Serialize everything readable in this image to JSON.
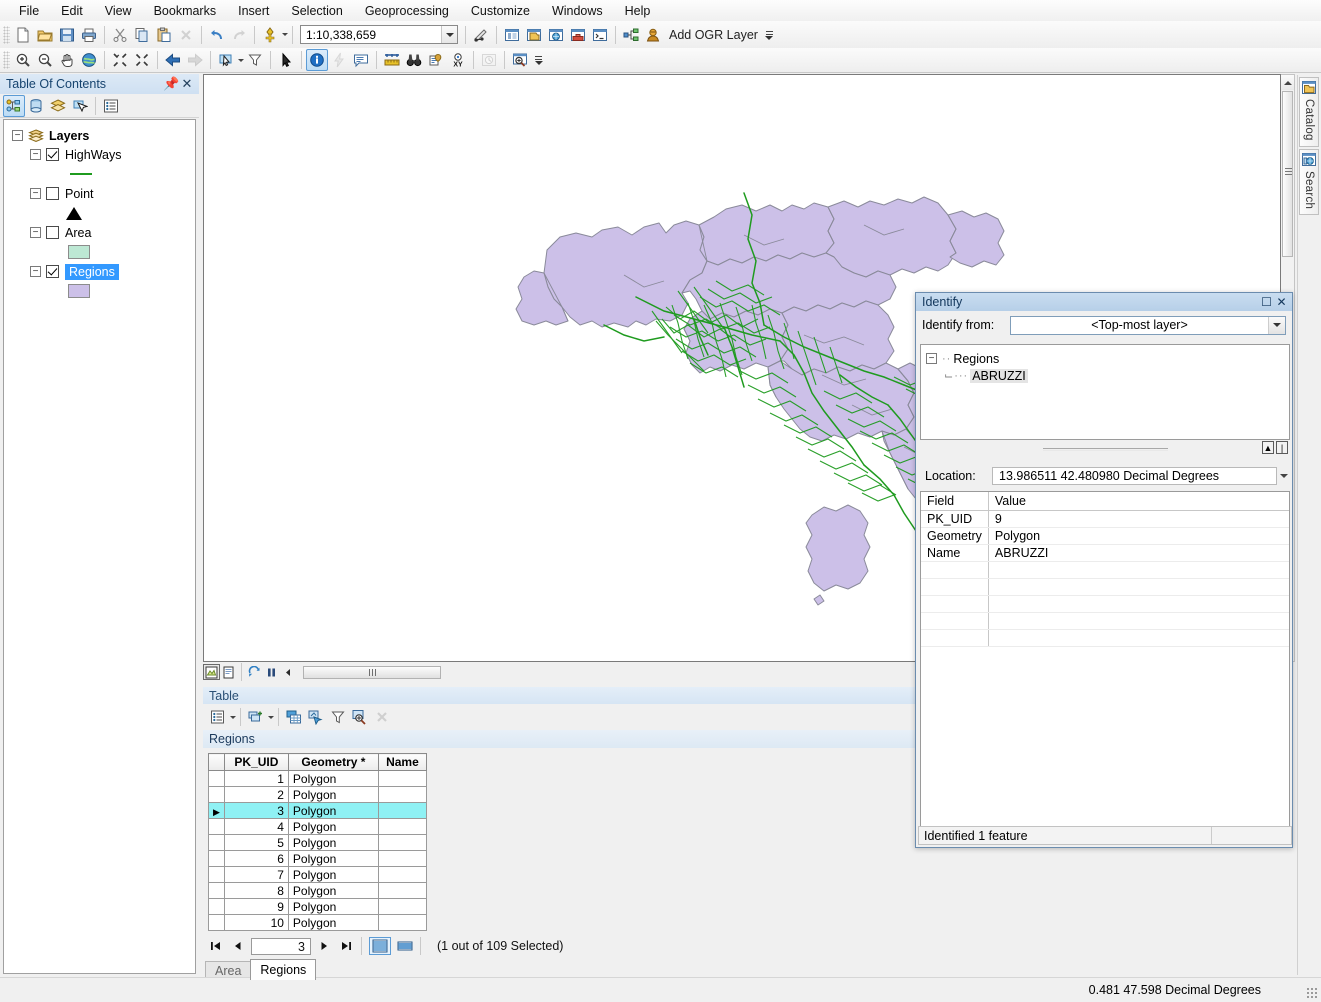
{
  "menubar": {
    "items": [
      {
        "label": "File"
      },
      {
        "label": "Edit"
      },
      {
        "label": "View"
      },
      {
        "label": "Bookmarks"
      },
      {
        "label": "Insert"
      },
      {
        "label": "Selection"
      },
      {
        "label": "Geoprocessing"
      },
      {
        "label": "Customize"
      },
      {
        "label": "Windows"
      },
      {
        "label": "Help"
      }
    ]
  },
  "toolbar_standard": {
    "scale_value": "1:10,338,659",
    "add_ogr_layer_label": "Add OGR Layer",
    "icons": [
      "new-document-icon",
      "open-folder-icon",
      "save-icon",
      "print-icon",
      "cut-scissors-icon",
      "copy-icon",
      "paste-icon",
      "delete-x-icon",
      "undo-icon",
      "redo-icon",
      "add-data-icon",
      "editor-toolbar-icon",
      "table-of-contents-icon",
      "catalog-window-icon",
      "search-window-icon",
      "arctoolbox-icon",
      "python-window-icon",
      "model-builder-icon",
      "ogr-layer-icon"
    ]
  },
  "toolbar_tools": {
    "icons": [
      "zoom-in-icon",
      "zoom-out-icon",
      "pan-hand-icon",
      "full-extent-globe-icon",
      "fixed-zoom-in-icon",
      "fixed-zoom-out-icon",
      "previous-extent-arrow-icon",
      "next-extent-arrow-icon",
      "select-features-icon",
      "clear-selection-icon",
      "select-elements-arrow-icon",
      "identify-info-icon",
      "hyperlink-lightning-icon",
      "html-popup-icon",
      "measure-ruler-icon",
      "find-binoculars-icon",
      "find-route-icon",
      "go-to-xy-icon",
      "time-slider-icon",
      "create-viewer-window-icon"
    ],
    "active_tool": "identify-info-icon"
  },
  "toc": {
    "title": "Table Of Contents",
    "pin_icon": "pin-icon",
    "close_icon": "close-icon",
    "tool_icons": [
      "list-by-drawing-order-icon",
      "list-by-source-icon",
      "list-by-visibility-icon",
      "list-by-selection-icon",
      "options-icon"
    ],
    "active_tool_index": 0,
    "root": {
      "label": "Layers",
      "expanded": true
    },
    "layers": [
      {
        "label": "HighWays",
        "checked": true,
        "symbol": "line",
        "symbol_color": "#1f9b1f"
      },
      {
        "label": "Point",
        "checked": false,
        "symbol": "triangle",
        "symbol_color": "#000000"
      },
      {
        "label": "Area",
        "checked": false,
        "symbol": "square",
        "symbol_color": "#bde8d4"
      },
      {
        "label": "Regions",
        "checked": true,
        "symbol": "square",
        "symbol_color": "#ccc0e8",
        "selected": true
      }
    ]
  },
  "map": {
    "background": "#ffffff",
    "region_fill": "#ccc0e8",
    "region_stroke": "#8a8a9a",
    "highway_color": "#1f9b1f",
    "selected_feature_color": "#22e0f0",
    "toolbar_icons": [
      "data-view-icon",
      "layout-view-icon",
      "refresh-icon",
      "pause-drawing-icon",
      "previous-icon"
    ],
    "active_view": "data-view-icon",
    "vscroll_up_icon": "scroll-up-arrow-icon",
    "vscroll_down_icon": "scroll-down-arrow-icon"
  },
  "table_panel": {
    "title": "Table",
    "tool_icons": [
      "table-options-icon",
      "related-tables-icon",
      "open-attribute-table-icon",
      "select-by-attributes-icon",
      "clear-selection-icon",
      "zoom-to-selected-icon",
      "delete-selected-icon"
    ],
    "layer_name": "Regions",
    "columns": [
      "PK_UID",
      "Geometry *",
      "Name"
    ],
    "rows": [
      {
        "pk_uid": "1",
        "geometry": "Polygon",
        "name": "",
        "selected": false,
        "current": false
      },
      {
        "pk_uid": "2",
        "geometry": "Polygon",
        "name": "",
        "selected": false,
        "current": false
      },
      {
        "pk_uid": "3",
        "geometry": "Polygon",
        "name": "",
        "selected": true,
        "current": true
      },
      {
        "pk_uid": "4",
        "geometry": "Polygon",
        "name": "",
        "selected": false,
        "current": false
      },
      {
        "pk_uid": "5",
        "geometry": "Polygon",
        "name": "",
        "selected": false,
        "current": false
      },
      {
        "pk_uid": "6",
        "geometry": "Polygon",
        "name": "",
        "selected": false,
        "current": false
      },
      {
        "pk_uid": "7",
        "geometry": "Polygon",
        "name": "",
        "selected": false,
        "current": false
      },
      {
        "pk_uid": "8",
        "geometry": "Polygon",
        "name": "",
        "selected": false,
        "current": false
      },
      {
        "pk_uid": "9",
        "geometry": "Polygon",
        "name": "",
        "selected": false,
        "current": false
      },
      {
        "pk_uid": "10",
        "geometry": "Polygon",
        "name": "",
        "selected": false,
        "current": false
      }
    ],
    "nav": {
      "first_icon": "first-record-icon",
      "prev_icon": "previous-record-icon",
      "record_number": "3",
      "next_icon": "next-record-icon",
      "last_icon": "last-record-icon",
      "view_all_icon": "show-all-records-icon",
      "view_selected_icon": "show-selected-records-icon",
      "active_view": "show-all-records-icon",
      "selection_status": "(1 out of 109 Selected)"
    },
    "tabs": [
      {
        "label": "Area",
        "active": false
      },
      {
        "label": "Regions",
        "active": true
      }
    ]
  },
  "identify": {
    "title": "Identify",
    "maximize_icon": "maximize-icon",
    "close_icon": "close-icon",
    "from_label": "Identify from:",
    "from_value": "<Top-most layer>",
    "tree": {
      "layer": "Regions",
      "feature": "ABRUZZI"
    },
    "location_label": "Location:",
    "location_value": "13.986511  42.480980 Decimal Degrees",
    "fields_header": {
      "field": "Field",
      "value": "Value"
    },
    "fields": [
      {
        "field": "PK_UID",
        "value": "9"
      },
      {
        "field": "Geometry",
        "value": "Polygon"
      },
      {
        "field": "Name",
        "value": "ABRUZZI"
      }
    ],
    "status": "Identified 1 feature",
    "mini_buttons": [
      "collapse-all-icon",
      "expand-icon"
    ],
    "spin_icon": "spin-down-icon"
  },
  "side_tabs": [
    {
      "label": "Catalog",
      "icon": "catalog-icon"
    },
    {
      "label": "Search",
      "icon": "search-globe-icon"
    }
  ],
  "status_bar": {
    "coordinates": "0.481  47.598 Decimal Degrees"
  }
}
